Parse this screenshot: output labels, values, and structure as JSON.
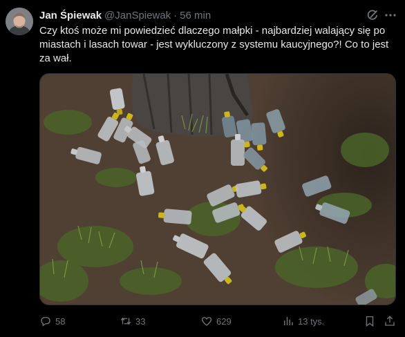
{
  "tweet": {
    "author_name": "Jan Śpiewak",
    "handle": "@JanSpiewak",
    "separator": "·",
    "time": "56 min",
    "text": "Czy ktoś może mi powiedzieć dlaczego małpki - najbardziej walający się po miastach i lasach towar - jest wykluczony z systemu kaucyjnego?! Co to jest za wał.",
    "media_icon": "photo-of-small-vodka-bottles-under-tree"
  },
  "actions": {
    "replies": "58",
    "reposts": "33",
    "likes": "629",
    "views": "13 tys."
  },
  "icons": [
    "grok-icon",
    "more-icon",
    "reply-icon",
    "repost-icon",
    "like-icon",
    "views-icon",
    "bookmark-icon",
    "share-icon"
  ],
  "colors": {
    "background": "#000000",
    "text": "#e7e9ea",
    "muted": "#71767b",
    "cap_yellow": "#d9c21a"
  }
}
